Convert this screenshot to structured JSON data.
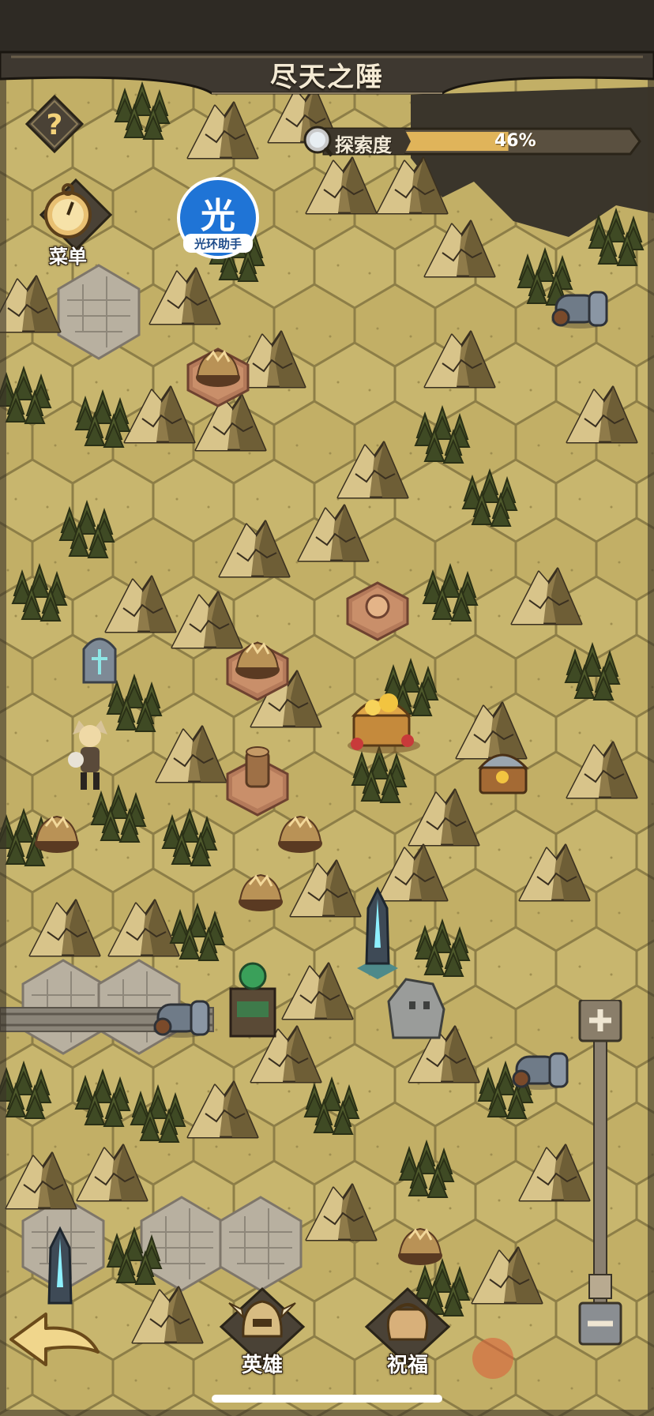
{
  "header": {
    "title": "尽天之陲",
    "help_icon": "question-mark-icon"
  },
  "menu": {
    "label": "菜单",
    "icon": "pocket-watch-icon"
  },
  "assistant": {
    "glyph": "光",
    "caption": "光环助手"
  },
  "exploration": {
    "label": "探索度",
    "value_text": "46%",
    "progress": 0.46,
    "icon": "magnifier-icon"
  },
  "bottom_bar": {
    "back_icon": "back-arrow-icon",
    "heroes_label": "英雄",
    "heroes_icon": "helmet-icon",
    "bless_label": "祝福",
    "bless_icon": "pouch-icon"
  },
  "zoom": {
    "in_icon": "plus-icon",
    "out_icon": "minus-icon"
  },
  "colors": {
    "grass": "#c6b46b",
    "grass_dark": "#a8965a",
    "frame": "#3a3328",
    "progress_fill": "#e0b45a",
    "assistant_blue": "#1f74d6"
  }
}
